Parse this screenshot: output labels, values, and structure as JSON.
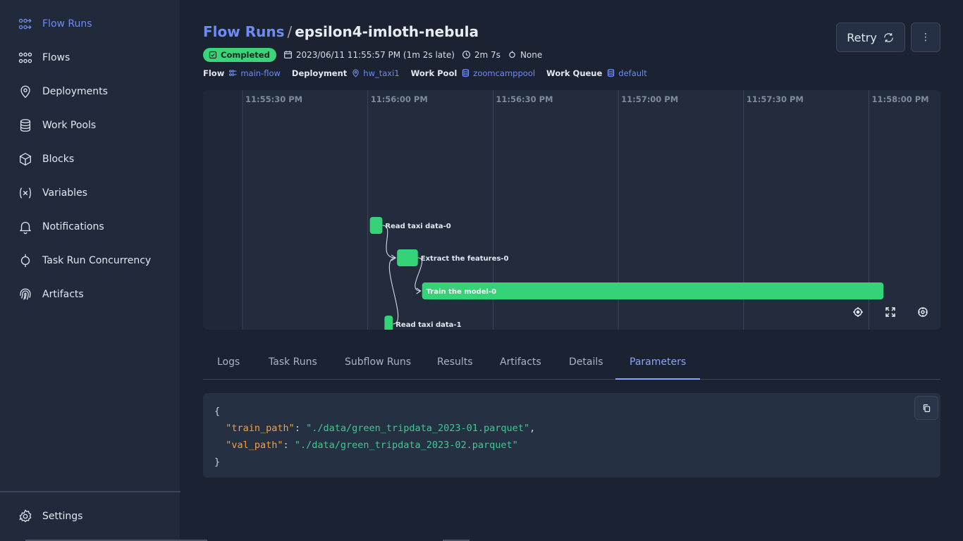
{
  "sidebar": {
    "items": [
      {
        "label": "Flow Runs",
        "icon": "flow-runs-icon",
        "active": true
      },
      {
        "label": "Flows",
        "icon": "flows-icon"
      },
      {
        "label": "Deployments",
        "icon": "map-pin-icon"
      },
      {
        "label": "Work Pools",
        "icon": "database-icon"
      },
      {
        "label": "Blocks",
        "icon": "cube-icon"
      },
      {
        "label": "Variables",
        "icon": "variable-icon"
      },
      {
        "label": "Notifications",
        "icon": "bell-icon"
      },
      {
        "label": "Task Run Concurrency",
        "icon": "concurrency-icon"
      },
      {
        "label": "Artifacts",
        "icon": "fingerprint-icon"
      }
    ],
    "settings": {
      "label": "Settings",
      "icon": "gear-icon"
    }
  },
  "header": {
    "breadcrumb_parent": "Flow Runs",
    "separator": "/",
    "run_name": "epsilon4-imloth-nebula",
    "retry_label": "Retry",
    "more_label": "⋮"
  },
  "meta": {
    "state": "Completed",
    "start_time": "2023/06/11 11:55:57 PM (1m 2s late)",
    "duration": "2m 7s",
    "tags": "None"
  },
  "links": {
    "flow_label": "Flow",
    "flow_value": "main-flow",
    "deployment_label": "Deployment",
    "deployment_value": "hw_taxi1",
    "work_pool_label": "Work Pool",
    "work_pool_value": "zoomcamppool",
    "work_queue_label": "Work Queue",
    "work_queue_value": "default"
  },
  "timeline": {
    "ticks": [
      "11:55:30 PM",
      "11:56:00 PM",
      "11:56:30 PM",
      "11:57:00 PM",
      "11:57:30 PM",
      "11:58:00 PM"
    ],
    "tasks": [
      {
        "name": "Read taxi data-0",
        "start": "11:56:00.5 PM",
        "end": "11:56:03.5 PM"
      },
      {
        "name": "Extract the features-0",
        "start": "11:56:07 PM",
        "end": "11:56:12 PM"
      },
      {
        "name": "Train the model-0",
        "start": "11:56:13 PM",
        "end": "11:58:03.5 PM"
      },
      {
        "name": "Read taxi data-1",
        "start": "11:56:04 PM",
        "end": "11:56:06 PM"
      }
    ],
    "bar_color": "#34d378"
  },
  "tabs": [
    "Logs",
    "Task Runs",
    "Subflow Runs",
    "Results",
    "Artifacts",
    "Details",
    "Parameters"
  ],
  "active_tab": "Parameters",
  "parameters": {
    "open": "{",
    "close": "}",
    "entries": [
      {
        "key": "\"train_path\"",
        "value": "\"./data/green_tripdata_2023-01.parquet\"",
        "comma": ","
      },
      {
        "key": "\"val_path\"",
        "value": "\"./data/green_tripdata_2023-02.parquet\"",
        "comma": ""
      }
    ]
  },
  "colors": {
    "accent": "#6d8cf5",
    "success": "#3ad57a",
    "json_key": "#f59e3b",
    "json_value": "#3dc991"
  }
}
